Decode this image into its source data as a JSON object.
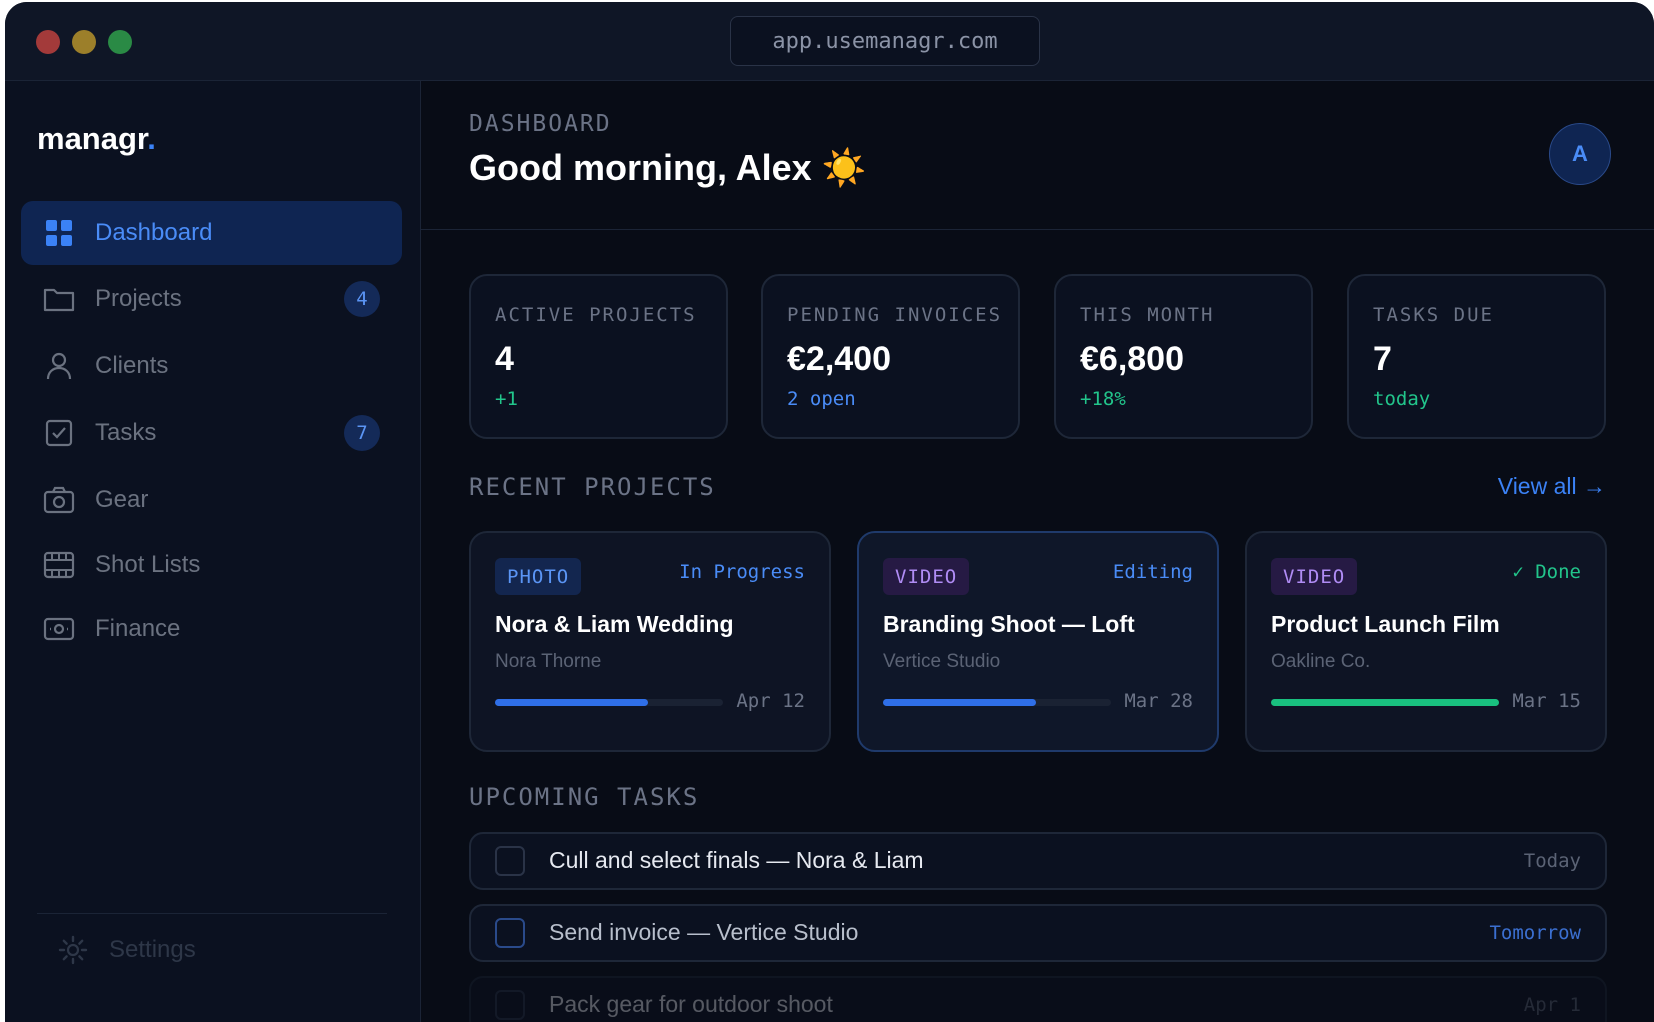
{
  "browser": {
    "url": "app.usemanagr.com"
  },
  "sidebar": {
    "logo_text": "managr",
    "logo_dot": ".",
    "items": [
      {
        "label": "Dashboard",
        "icon": "grid-icon",
        "active": true
      },
      {
        "label": "Projects",
        "icon": "folder-icon",
        "badge": "4"
      },
      {
        "label": "Clients",
        "icon": "user-icon"
      },
      {
        "label": "Tasks",
        "icon": "checkbox-icon",
        "badge": "7"
      },
      {
        "label": "Gear",
        "icon": "camera-icon"
      },
      {
        "label": "Shot Lists",
        "icon": "film-icon"
      },
      {
        "label": "Finance",
        "icon": "banknote-icon"
      }
    ],
    "settings_label": "Settings"
  },
  "header": {
    "crumb": "DASHBOARD",
    "greeting": "Good morning, Alex ☀️",
    "avatar_initial": "A"
  },
  "stats": [
    {
      "label": "ACTIVE PROJECTS",
      "value": "4",
      "sub": "+1"
    },
    {
      "label": "PENDING INVOICES",
      "value": "€2,400",
      "sub": "2 open"
    },
    {
      "label": "THIS MONTH",
      "value": "€6,800",
      "sub": "+18%"
    },
    {
      "label": "TASKS DUE",
      "value": "7",
      "sub": "today"
    }
  ],
  "recent_projects": {
    "title": "RECENT PROJECTS",
    "view_all": "View all →",
    "items": [
      {
        "tag": "PHOTO",
        "status": "In Progress",
        "title": "Nora & Liam Wedding",
        "client": "Nora Thorne",
        "date": "Apr 12",
        "progress": 0.67
      },
      {
        "tag": "VIDEO",
        "status": "Editing",
        "title": "Branding Shoot — Loft",
        "client": "Vertice Studio",
        "date": "Mar 28",
        "progress": 0.67
      },
      {
        "tag": "VIDEO",
        "status": "✓ Done",
        "title": "Product Launch Film",
        "client": "Oakline Co.",
        "date": "Mar 15",
        "progress": 1.0
      }
    ]
  },
  "upcoming_tasks": {
    "title": "UPCOMING TASKS",
    "items": [
      {
        "text": "Cull and select finals — Nora & Liam",
        "due": "Today"
      },
      {
        "text": "Send invoice — Vertice Studio",
        "due": "Tomorrow"
      },
      {
        "text": "Pack gear for outdoor shoot",
        "due": "Apr 1"
      }
    ]
  },
  "colors": {
    "accent": "#3b82f6",
    "success": "#22c58b",
    "video": "#b08cf5",
    "background": "#080c16"
  }
}
